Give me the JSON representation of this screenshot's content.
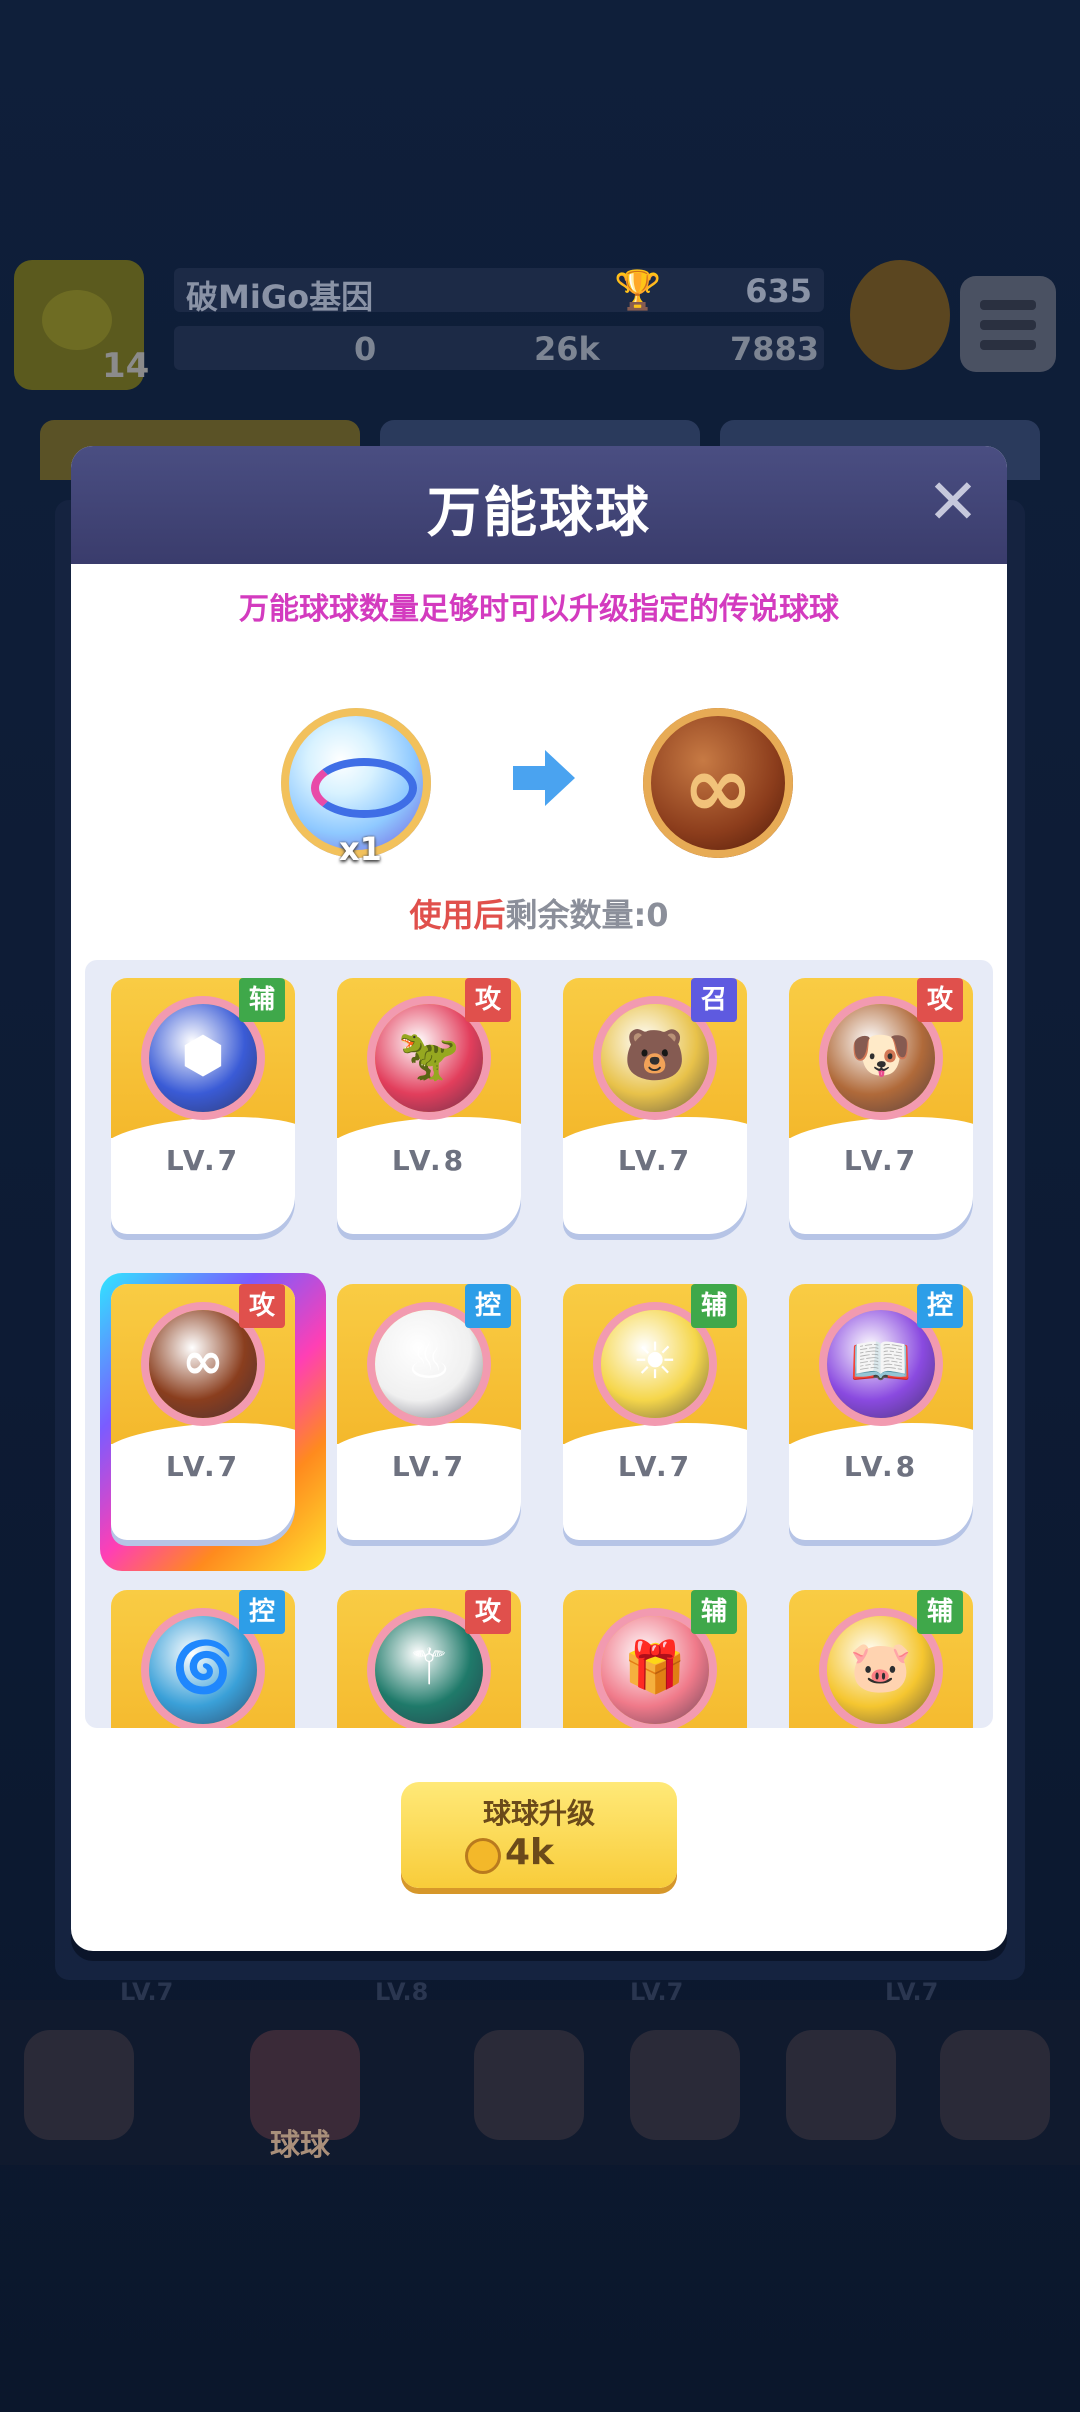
{
  "background": {
    "player_name": "破MiGo基因",
    "level": "14",
    "trophies": "635",
    "stats": [
      "0",
      "26k",
      "7883"
    ],
    "nav_label": "球球",
    "bottom_levels": [
      "LV.7",
      "LV.8",
      "LV.7",
      "LV.7"
    ]
  },
  "modal": {
    "title": "万能球球",
    "close_icon": "✕",
    "hint": "万能球球数量足够时可以升级指定的传说球球",
    "source_qty": "x1",
    "remaining_prefix": "使用后",
    "remaining_label": "剩余数量:",
    "remaining_value": "0",
    "upgrade_button": {
      "label": "球球升级",
      "cost": "4k"
    }
  },
  "colors": {
    "tag_assist": "#3fa84a",
    "tag_attack": "#e0504c",
    "tag_summon": "#5e5ae0",
    "tag_control": "#2d9ee8",
    "hint": "#d33bbf"
  },
  "balls": [
    {
      "name": "hexagon-ball",
      "tag": "辅",
      "tag_type": "assist",
      "level": "LV.7",
      "glyph": "⬢",
      "color": "#3a5bd6",
      "selected": false
    },
    {
      "name": "dinosaur-ball",
      "tag": "攻",
      "tag_type": "attack",
      "level": "LV.8",
      "glyph": "🦖",
      "color": "#e23e5c",
      "selected": false
    },
    {
      "name": "bear-ball",
      "tag": "召",
      "tag_type": "summon",
      "level": "LV.7",
      "glyph": "🐻",
      "color": "#e8c24a",
      "selected": false
    },
    {
      "name": "dog-ball",
      "tag": "攻",
      "tag_type": "attack",
      "level": "LV.7",
      "glyph": "🐶",
      "color": "#b06a3a",
      "selected": false
    },
    {
      "name": "infinity-ball",
      "tag": "攻",
      "tag_type": "attack",
      "level": "LV.7",
      "glyph": "∞",
      "color": "#8a3e1e",
      "selected": true
    },
    {
      "name": "flame-ball",
      "tag": "控",
      "tag_type": "control",
      "level": "LV.7",
      "glyph": "♨",
      "color": "#f0f0f0",
      "selected": false
    },
    {
      "name": "sun-ball",
      "tag": "辅",
      "tag_type": "assist",
      "level": "LV.7",
      "glyph": "☀",
      "color": "#f5d64a",
      "selected": false
    },
    {
      "name": "spellbook-ball",
      "tag": "控",
      "tag_type": "control",
      "level": "LV.8",
      "glyph": "📖",
      "color": "#8a4ae0",
      "selected": false
    },
    {
      "name": "wind-ball",
      "tag": "控",
      "tag_type": "control",
      "level": "",
      "glyph": "🌀",
      "color": "#3aa0d8",
      "selected": false
    },
    {
      "name": "bow-ball",
      "tag": "攻",
      "tag_type": "attack",
      "level": "",
      "glyph": "⚚",
      "color": "#1f7a6a",
      "selected": false
    },
    {
      "name": "gift-ball",
      "tag": "辅",
      "tag_type": "assist",
      "level": "",
      "glyph": "🎁",
      "color": "#f07a8a",
      "selected": false
    },
    {
      "name": "piggy-bank-ball",
      "tag": "辅",
      "tag_type": "assist",
      "level": "",
      "glyph": "🐷",
      "color": "#f5c630",
      "selected": false
    }
  ]
}
